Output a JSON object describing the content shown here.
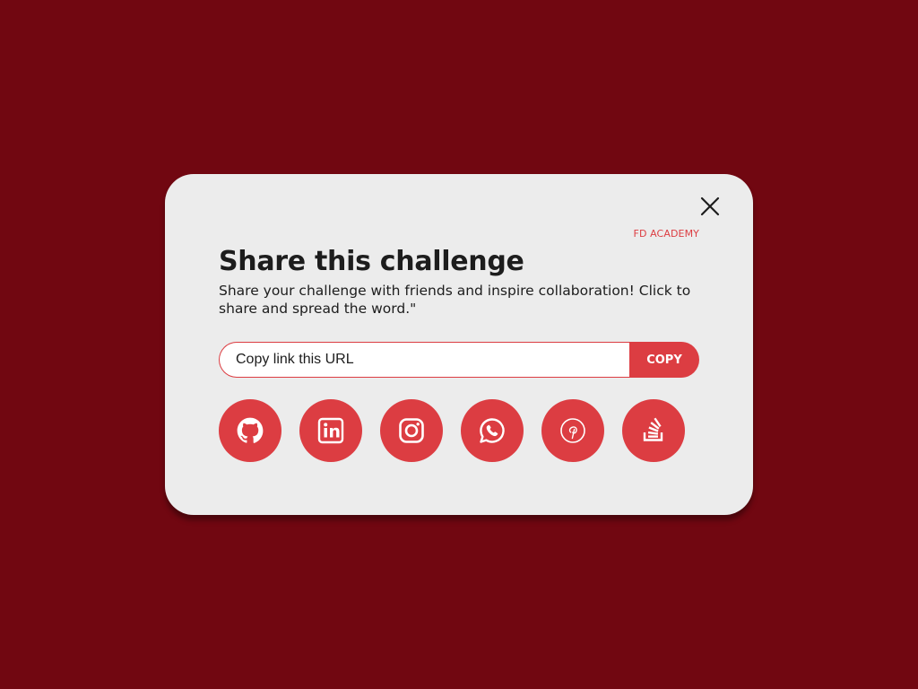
{
  "colors": {
    "background": "#710711",
    "card": "#ececec",
    "accent": "#dc3d42",
    "text": "#1d1d1d"
  },
  "modal": {
    "brand": "FD ACADEMY",
    "title": "Share this challenge",
    "subtitle": "Share your challenge with friends and inspire collaboration! Click to share and spread the word.\"",
    "close_icon": "close-icon"
  },
  "link_field": {
    "placeholder": "Copy link this URL",
    "value": ""
  },
  "copy_button": {
    "label": "COPY"
  },
  "social_links": [
    {
      "name": "GitHub",
      "icon": "github-icon"
    },
    {
      "name": "LinkedIn",
      "icon": "linkedin-icon"
    },
    {
      "name": "Instagram",
      "icon": "instagram-icon"
    },
    {
      "name": "WhatsApp",
      "icon": "whatsapp-icon"
    },
    {
      "name": "Pinterest",
      "icon": "pinterest-icon"
    },
    {
      "name": "Stack Overflow",
      "icon": "stackoverflow-icon"
    }
  ]
}
